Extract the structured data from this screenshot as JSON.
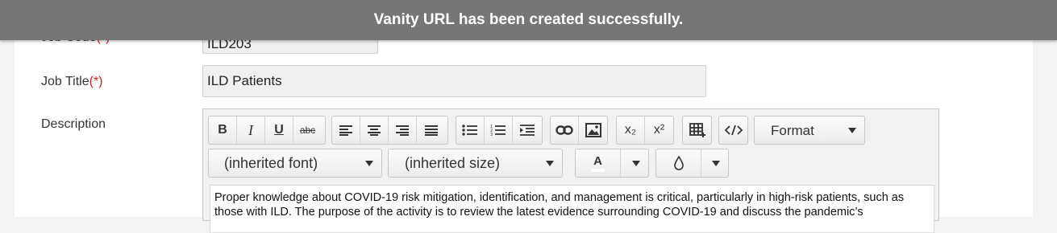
{
  "toast": {
    "message": "Vanity URL has been created successfully."
  },
  "form": {
    "job_code": {
      "label": "Job Code",
      "required": "(*)",
      "value": "ILD203"
    },
    "job_title": {
      "label": "Job Title",
      "required": "(*)",
      "value": "ILD Patients"
    },
    "description": {
      "label": "Description"
    }
  },
  "editor": {
    "toolbar": {
      "bold": "B",
      "italic": "I",
      "underline": "U",
      "strike": "abc",
      "subscript": "x₂",
      "superscript": "x²",
      "format": "Format",
      "font": "(inherited font)",
      "size": "(inherited size)",
      "text_color": "A"
    },
    "content": "Proper knowledge about COVID-19 risk mitigation, identification, and management is critical, particularly in high-risk patients, such as those with ILD. The purpose of the activity is to review the latest evidence surrounding COVID-19 and discuss the pandemic’s"
  }
}
